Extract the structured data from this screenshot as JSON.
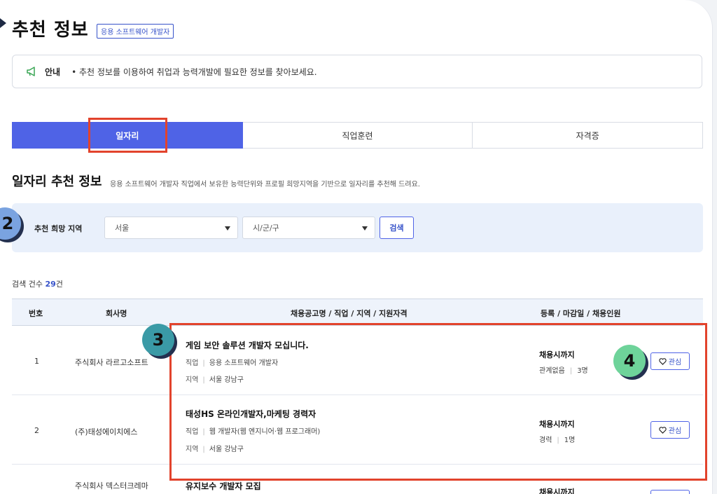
{
  "page": {
    "title": "추천 정보",
    "badge": "응용 소프트웨어 개발자"
  },
  "notice": {
    "label": "안내",
    "text": "• 추천 정보를 이용하여 취업과 능력개발에 필요한 정보를 찾아보세요."
  },
  "tabs": [
    {
      "label": "일자리",
      "active": true
    },
    {
      "label": "직업훈련",
      "active": false
    },
    {
      "label": "자격증",
      "active": false
    }
  ],
  "section": {
    "title": "일자리 추천 정보",
    "desc": "응용 소프트웨어 개발자 직업에서 보유한 능력단위와 프로필 희망지역을 기반으로 일자리를 추천해 드려요."
  },
  "filter": {
    "label": "추천 희망 지역",
    "region": "서울",
    "district": "시/군/구",
    "search": "검색"
  },
  "count": {
    "prefix": "검색 건수",
    "value": "29",
    "suffix": "건"
  },
  "table": {
    "headers": [
      "번호",
      "회사명",
      "채용공고명 / 직업 / 지역 / 지원자격",
      "등록 / 마감일 / 채용인원"
    ],
    "rows": [
      {
        "no": "1",
        "company": "주식회사 라르고소프트",
        "title": "게임 보안 솔루션 개발자 모십니다.",
        "job_key": "직업",
        "job": "응용 소프트웨어 개발자",
        "region_key": "지역",
        "region": "서울 강남구",
        "deadline": "채용시까지",
        "career": "관계없음",
        "headcount": "3명",
        "interest": "관심"
      },
      {
        "no": "2",
        "company": "(주)태성에이치에스",
        "title": "태성HS 온라인개발자,마케팅 경력자",
        "job_key": "직업",
        "job": "웹 개발자(웹 엔지니어·웹 프로그래머)",
        "region_key": "지역",
        "region": "서울 강남구",
        "deadline": "채용시까지",
        "career": "경력",
        "headcount": "1명",
        "interest": "관심"
      },
      {
        "company": "주식회사 덱스터크레마",
        "title": "유지보수 개발자 모집",
        "deadline": "채용시까지"
      }
    ]
  },
  "markers": [
    "2",
    "3",
    "4"
  ],
  "colors": {
    "accent": "#4f63e6",
    "highlight": "#e2432c",
    "marker_blue": "#7aa3e0",
    "marker_teal": "#3a9aa6",
    "marker_green": "#6ed39a"
  }
}
